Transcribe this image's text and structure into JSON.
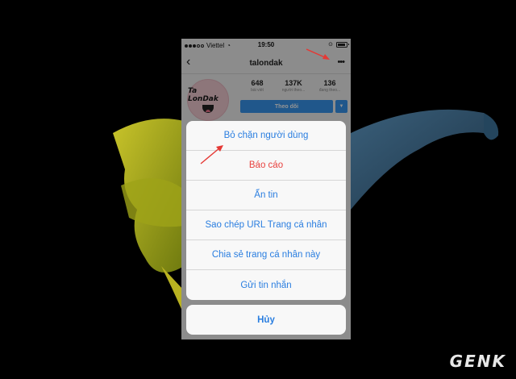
{
  "status_bar": {
    "carrier": "Viettel",
    "time": "19:50"
  },
  "nav": {
    "back_icon": "chevron-left-icon",
    "title": "talondak",
    "more_icon": "ellipsis-icon"
  },
  "profile": {
    "avatar_text": "Ta LonDak",
    "stats": [
      {
        "value": "648",
        "label": "bài viết"
      },
      {
        "value": "137K",
        "label": "người theo..."
      },
      {
        "value": "136",
        "label": "đang theo..."
      }
    ],
    "follow_label": "Theo dõi"
  },
  "action_sheet": {
    "items": [
      {
        "label": "Bỏ chặn người dùng",
        "style": "default"
      },
      {
        "label": "Báo cáo",
        "style": "destructive"
      },
      {
        "label": "Ẩn tin",
        "style": "default"
      },
      {
        "label": "Sao chép URL Trang cá nhân",
        "style": "default"
      },
      {
        "label": "Chia sẻ trang cá nhân này",
        "style": "default"
      },
      {
        "label": "Gửi tin nhắn",
        "style": "default"
      }
    ],
    "cancel_label": "Hủy"
  },
  "watermark": "GENK",
  "colors": {
    "accent": "#2a7ee0",
    "destructive": "#e8423f",
    "follow": "#3897f0",
    "annotation": "#e53935"
  }
}
